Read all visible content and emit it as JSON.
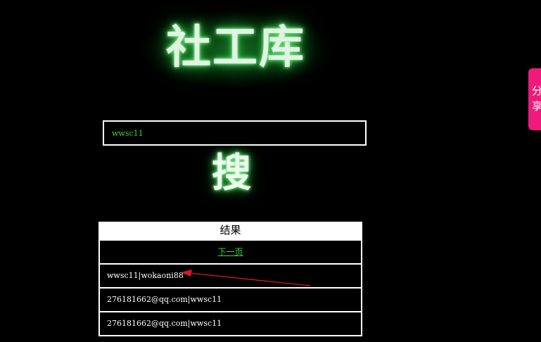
{
  "logo": {
    "text": "社工库"
  },
  "search": {
    "value": "wwsc11",
    "button_label": "搜"
  },
  "results": {
    "header": "结果",
    "next_page_label": "下一页",
    "rows": [
      "wwsc11|wokaoni88",
      "276181662@qq.com|wwsc11",
      "276181662@qq.com|wwsc11"
    ]
  },
  "share_tab": {
    "char1": "分",
    "char2": "享"
  },
  "colors": {
    "background": "#000000",
    "text_green": "#3ad63a",
    "glow_green": "#46d85a",
    "share_pink": "#ef1a7c",
    "arrow_red": "#d81a1a"
  }
}
